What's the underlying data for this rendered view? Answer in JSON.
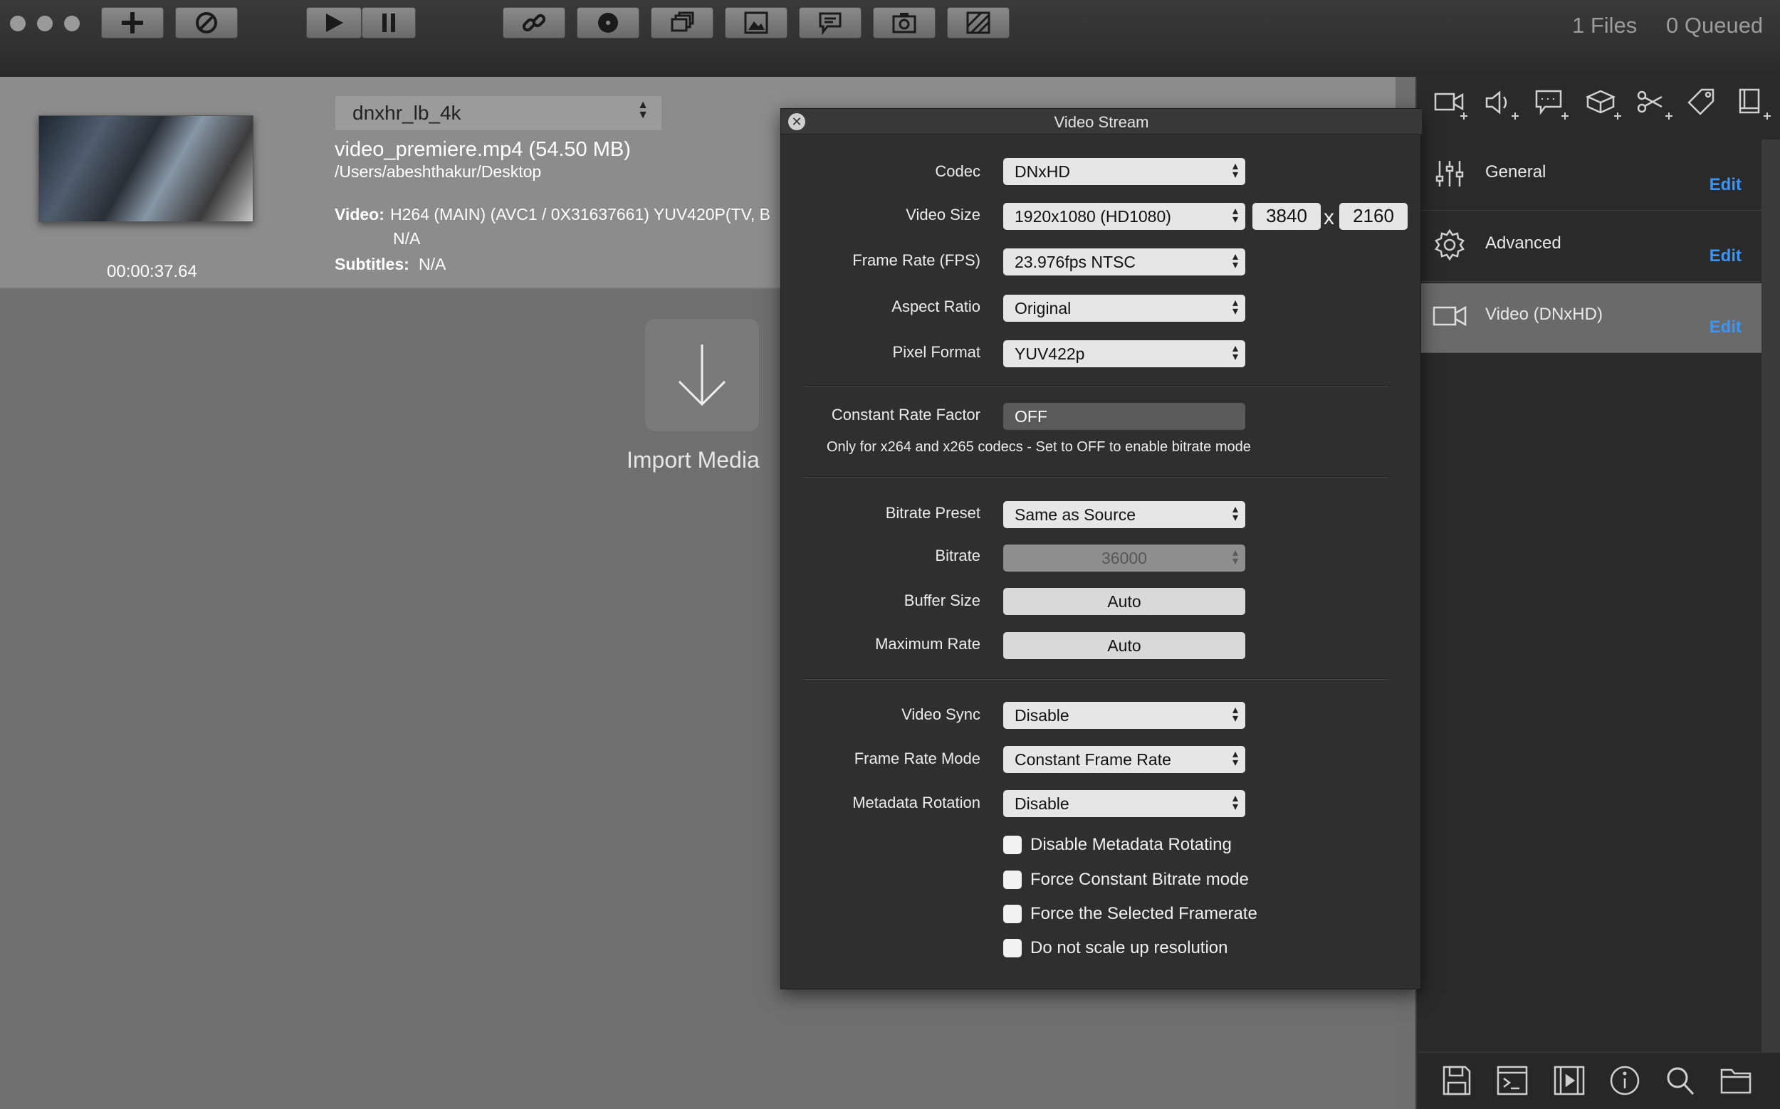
{
  "toolbar": {
    "files_count": "1 Files",
    "queued_count": "0 Queued"
  },
  "media": {
    "preset": "dnxhr_lb_4k",
    "filename_size": "video_premiere.mp4  (54.50 MB)",
    "path": "/Users/abeshthakur/Desktop",
    "video_label": "Video:",
    "video_info": "H264 (MAIN) (AVC1 / 0X31637661)   YUV420P(TV, B",
    "video_info_2": "N/A",
    "subtitles_label": "Subtitles:",
    "subtitles_value": "N/A",
    "duration": "00:00:37.64"
  },
  "import": {
    "label": "Import Media"
  },
  "dialog": {
    "title": "Video Stream",
    "codec": {
      "label": "Codec",
      "value": "DNxHD"
    },
    "video_size": {
      "label": "Video Size",
      "value": "1920x1080 (HD1080)",
      "width": "3840",
      "x": "x",
      "height": "2160"
    },
    "frame_rate": {
      "label": "Frame Rate (FPS)",
      "value": "23.976fps NTSC"
    },
    "aspect_ratio": {
      "label": "Aspect Ratio",
      "value": "Original"
    },
    "pixel_format": {
      "label": "Pixel Format",
      "value": "YUV422p"
    },
    "crf": {
      "label": "Constant Rate Factor",
      "value": "OFF"
    },
    "crf_note": "Only for x264 and x265 codecs   -   Set to OFF to enable bitrate mode",
    "bitrate_preset": {
      "label": "Bitrate Preset",
      "value": "Same as Source"
    },
    "bitrate": {
      "label": "Bitrate",
      "value": "36000"
    },
    "buffer_size": {
      "label": "Buffer Size",
      "value": "Auto"
    },
    "max_rate": {
      "label": "Maximum Rate",
      "value": "Auto"
    },
    "video_sync": {
      "label": "Video Sync",
      "value": "Disable"
    },
    "frame_rate_mode": {
      "label": "Frame Rate Mode",
      "value": "Constant Frame Rate"
    },
    "metadata_rotation": {
      "label": "Metadata Rotation",
      "value": "Disable"
    },
    "checkboxes": [
      {
        "label": "Disable Metadata Rotating",
        "checked": false
      },
      {
        "label": "Force Constant Bitrate mode",
        "checked": false
      },
      {
        "label": "Force the Selected Framerate",
        "checked": false
      },
      {
        "label": "Do not scale up resolution",
        "checked": false
      }
    ]
  },
  "right_panel": {
    "items": [
      {
        "label": "General",
        "edit": "Edit"
      },
      {
        "label": "Advanced",
        "edit": "Edit"
      },
      {
        "label": "Video (DNxHD)",
        "edit": "Edit",
        "selected": true
      }
    ]
  },
  "colors": {
    "accent": "#3b95f5",
    "dialog_bg": "#2f2f2f",
    "panel_bg": "#2a2a2a"
  }
}
